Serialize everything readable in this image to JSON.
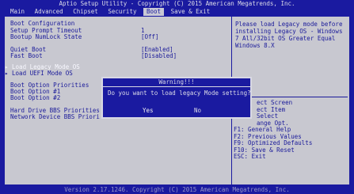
{
  "title": "Aptio Setup Utility - Copyright (C) 2015 American Megatrends, Inc.",
  "menu": [
    {
      "label": "Main",
      "active": false
    },
    {
      "label": "Advanced",
      "active": false
    },
    {
      "label": "Chipset",
      "active": false
    },
    {
      "label": "Security",
      "active": false
    },
    {
      "label": "Boot",
      "active": true
    },
    {
      "label": "Save & Exit",
      "active": false
    }
  ],
  "main": {
    "boot_config_heading": "Boot Configuration",
    "setup_prompt_timeout_label": "Setup Prompt Timeout",
    "setup_prompt_timeout_value": "1",
    "bootup_numlock_label": "Bootup NumLock State",
    "bootup_numlock_value": "[Off]",
    "quiet_boot_label": "Quiet Boot",
    "quiet_boot_value": "[Enabled]",
    "fast_boot_label": "Fast Boot",
    "fast_boot_value": "[Disabled]",
    "load_legacy_label": "Load Legacy Mode OS",
    "load_uefi_label": "Load UEFI Mode OS",
    "boot_option_priorities_heading": "Boot Option Priorities",
    "boot_option_1_label": "Boot Option #1",
    "boot_option_2_label": "Boot Option #2",
    "hdd_bbs_label": "Hard Drive BBS Priorities",
    "network_bbs_label": "Network Device BBS Priori"
  },
  "side": {
    "help_text": "Please load Legacy mode before\ninstalling Legacy OS - Windows\n7 All/32bit OS Greater Equal\nWindows 8.X",
    "keys": [
      "ect Screen",
      "ect Item",
      "Select",
      "ange Opt.",
      "F1: General Help",
      "F2: Previous Values",
      "F9: Optimized Defaults",
      "F10: Save & Reset",
      "ESC: Exit"
    ]
  },
  "dialog": {
    "title": "Warning!!!",
    "message": "Do you want to load legacy Mode setting?",
    "yes_label": "Yes",
    "no_label": "No"
  },
  "footer": "Version 2.17.1246. Copyright (C) 2015 American Megatrends, Inc."
}
